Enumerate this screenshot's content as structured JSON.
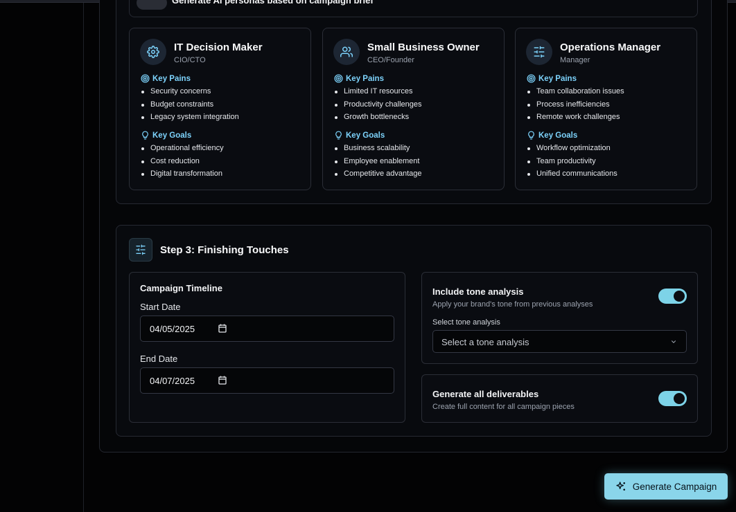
{
  "ai_personas": {
    "label": "Generate AI personas based on campaign brief"
  },
  "personas": [
    {
      "title": "IT Decision Maker",
      "subtitle": "CIO/CTO",
      "icon": "gear-icon",
      "pains_label": "Key Pains",
      "pains": [
        "Security concerns",
        "Budget constraints",
        "Legacy system integration"
      ],
      "goals_label": "Key Goals",
      "goals": [
        "Operational efficiency",
        "Cost reduction",
        "Digital transformation"
      ]
    },
    {
      "title": "Small Business Owner",
      "subtitle": "CEO/Founder",
      "icon": "users-icon",
      "pains_label": "Key Pains",
      "pains": [
        "Limited IT resources",
        "Productivity challenges",
        "Growth bottlenecks"
      ],
      "goals_label": "Key Goals",
      "goals": [
        "Business scalability",
        "Employee enablement",
        "Competitive advantage"
      ]
    },
    {
      "title": "Operations Manager",
      "subtitle": "Manager",
      "icon": "sliders-icon",
      "pains_label": "Key Pains",
      "pains": [
        "Team collaboration issues",
        "Process inefficiencies",
        "Remote work challenges"
      ],
      "goals_label": "Key Goals",
      "goals": [
        "Workflow optimization",
        "Team productivity",
        "Unified communications"
      ]
    }
  ],
  "step3": {
    "title": "Step 3: Finishing Touches",
    "timeline": {
      "title": "Campaign Timeline",
      "start_label": "Start Date",
      "start_value": "04/05/2025",
      "end_label": "End Date",
      "end_value": "04/07/2025"
    },
    "tone": {
      "title": "Include tone analysis",
      "desc": "Apply your brand's tone from previous analyses",
      "enabled": true,
      "select_label": "Select tone analysis",
      "select_placeholder": "Select a tone analysis"
    },
    "deliverables": {
      "title": "Generate all deliverables",
      "desc": "Create full content for all campaign pieces",
      "enabled": true
    }
  },
  "generate_button": {
    "label": "Generate Campaign"
  },
  "colors": {
    "accent": "#7dd3e8",
    "background": "#030304",
    "card": "#0a0c11"
  }
}
